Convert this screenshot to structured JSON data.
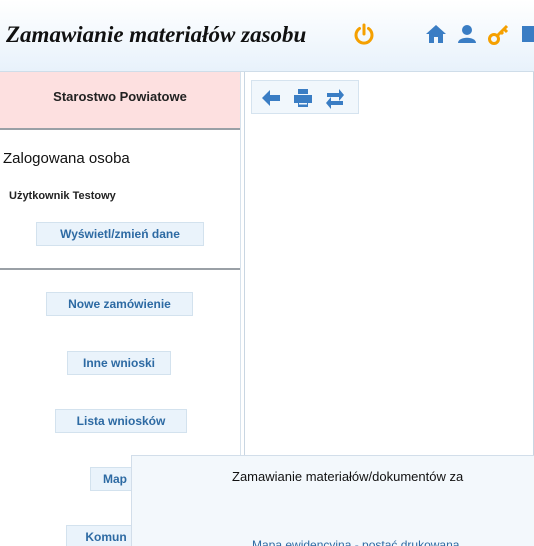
{
  "header": {
    "title": "Zamawianie materiałów zasobu",
    "icons": [
      "power-icon",
      "home-icon",
      "user-icon",
      "key-icon"
    ],
    "accent_color": "#f5a000",
    "icon_color": "#3a7dc4"
  },
  "sidebar": {
    "organization": "Starostwo Powiatowe",
    "section_title": "Zalogowana osoba",
    "user_name": "Użytkownik Testowy",
    "profile_button": "Wyświetl/zmień dane",
    "menu": [
      "Nowe zamówienie",
      "Inne wnioski",
      "Lista wniosków",
      "Map",
      "Komun"
    ]
  },
  "main": {
    "toolbar_icons": [
      "arrow-left-icon",
      "print-icon",
      "refresh-icon"
    ]
  },
  "panel": {
    "title": "Zamawianie materiałów/dokumentów za",
    "link": "Mapa ewidencyjna - postać drukowana"
  }
}
